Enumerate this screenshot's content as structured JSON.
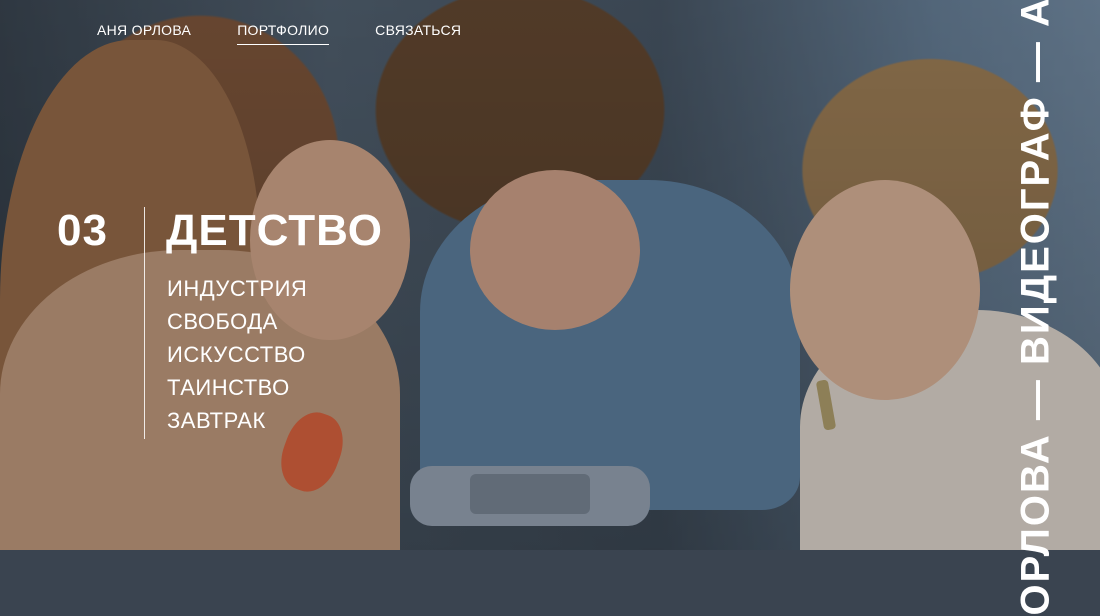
{
  "nav": {
    "items": [
      {
        "label": "АНЯ ОРЛОВА",
        "active": false
      },
      {
        "label": "ПОРТФОЛИО",
        "active": true
      },
      {
        "label": "СВЯЗАТЬСЯ",
        "active": false
      }
    ]
  },
  "section": {
    "number": "03",
    "title": "ДЕТСТВО",
    "items": [
      "ИНДУСТРИЯ",
      "СВОБОДА",
      "ИСКУССТВО",
      "ТАИНСТВО",
      "ЗАВТРАК"
    ]
  },
  "vertical_text": "ОРЛОВА — ВИДЕОГРАФ — АНЯ"
}
